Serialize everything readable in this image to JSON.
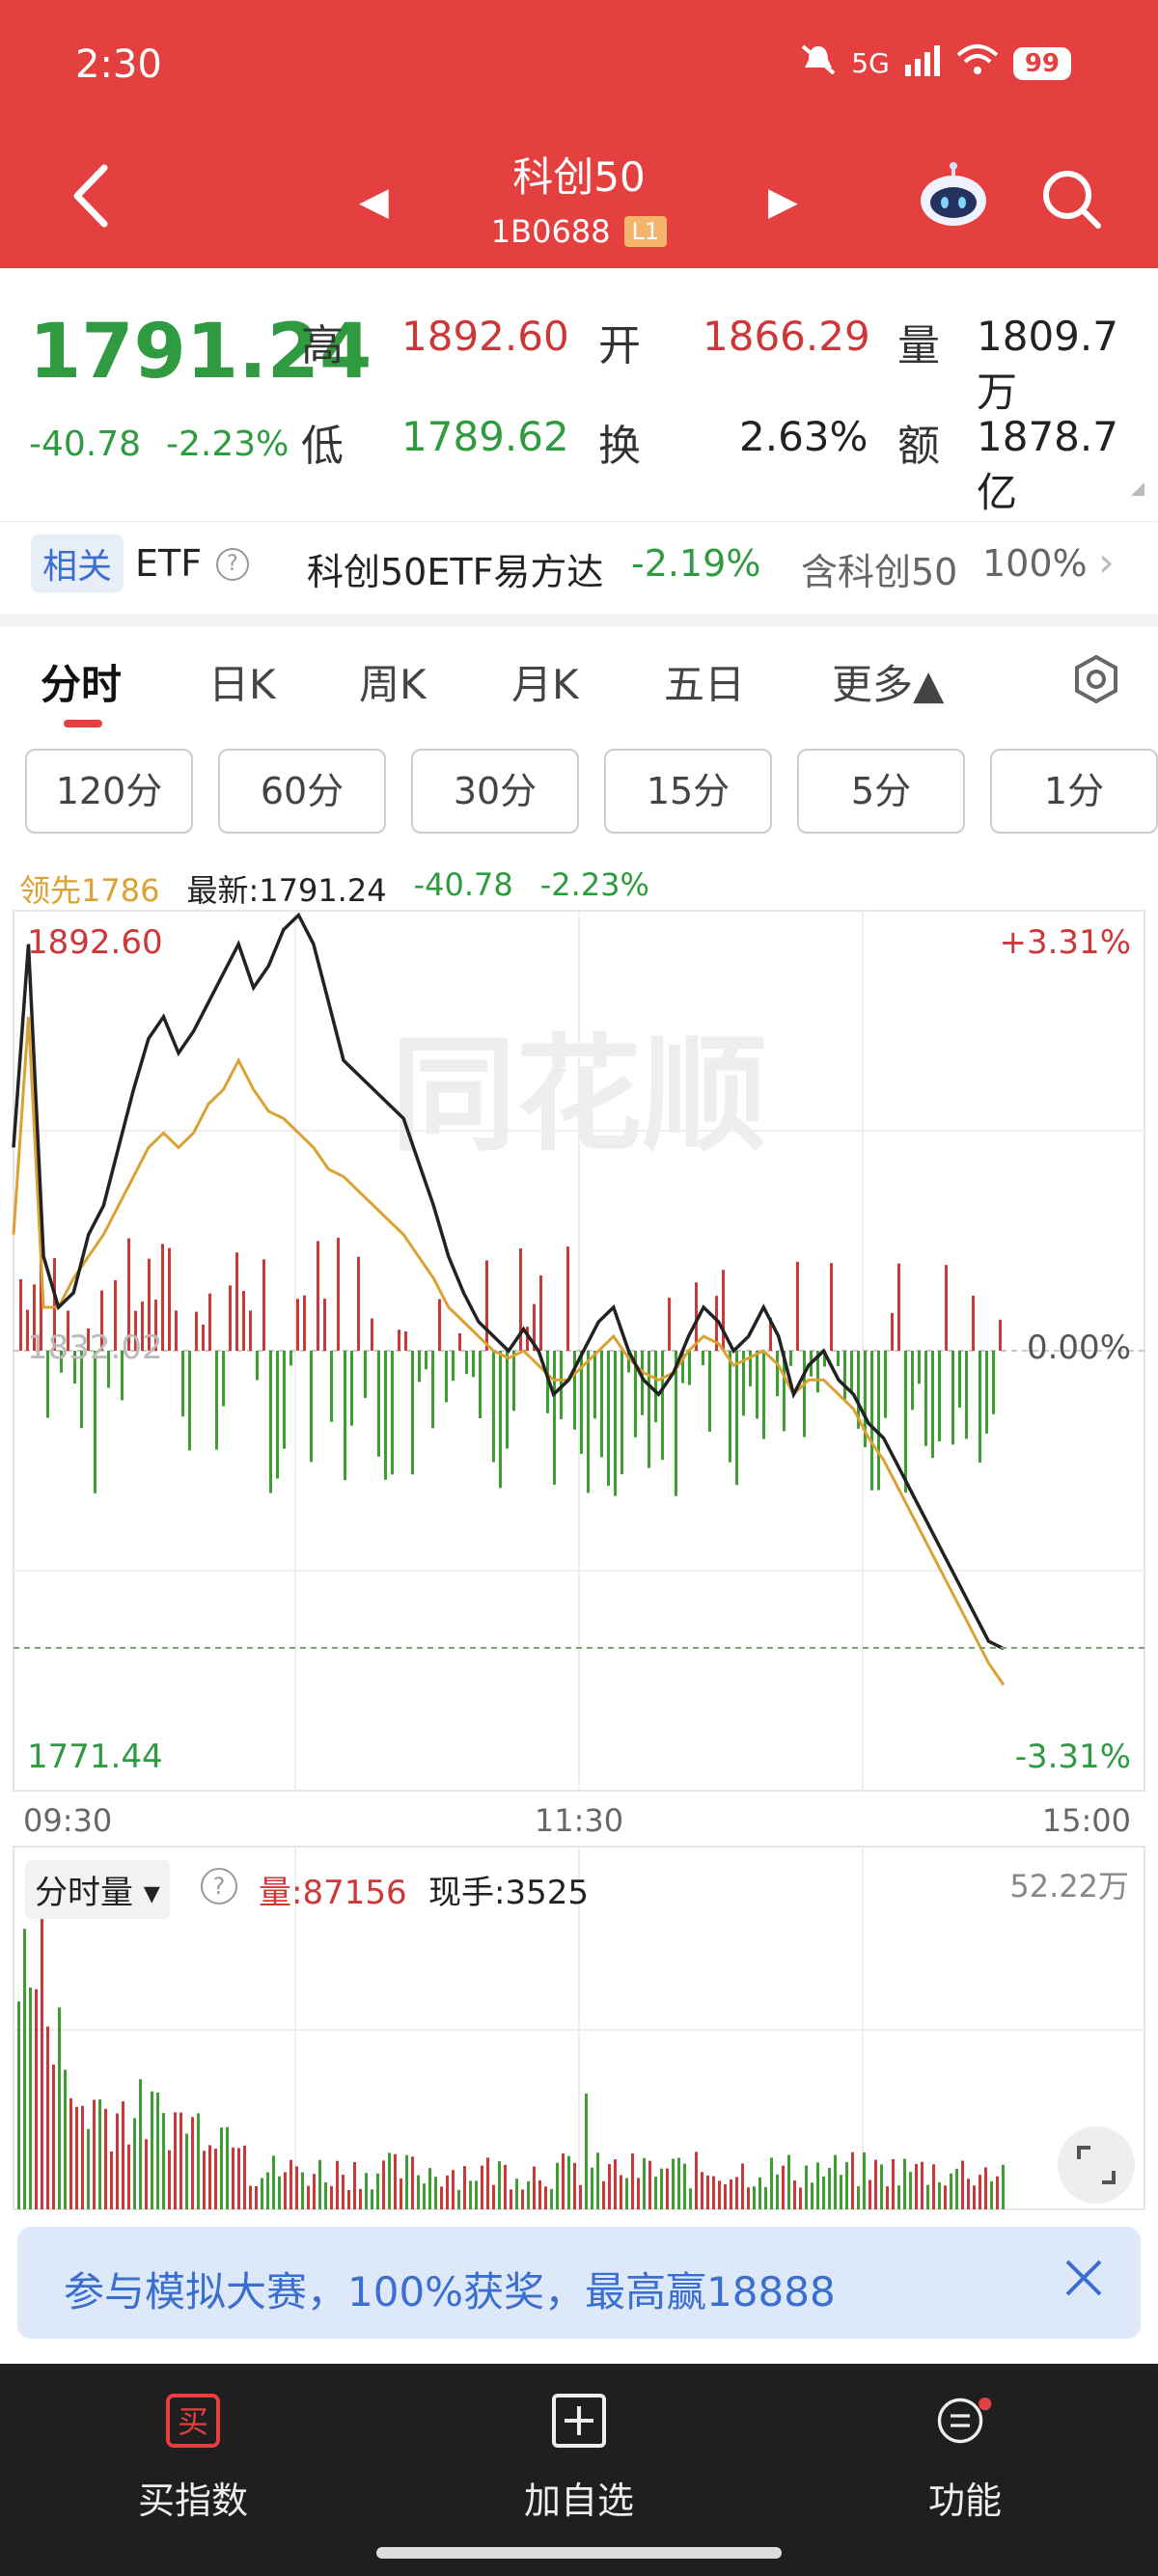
{
  "status": {
    "time": "2:30",
    "network": "5G",
    "battery": "99"
  },
  "header": {
    "title": "科创50",
    "code": "1B0688",
    "level": "L1"
  },
  "quote": {
    "price": "1791.24",
    "change": "-40.78",
    "change_pct": "-2.23%",
    "high_label": "高",
    "high": "1892.60",
    "open_label": "开",
    "open": "1866.29",
    "vol_label": "量",
    "volume": "1809.7万",
    "low_label": "低",
    "low": "1789.62",
    "turn_label": "换",
    "turnover": "2.63%",
    "amt_label": "额",
    "amount": "1878.7亿"
  },
  "etf": {
    "related": "相关",
    "label": "ETF",
    "help": "?",
    "name": "科创50ETF易方达",
    "change_pct": "-2.19%",
    "contains": "含科创50",
    "weight": "100%"
  },
  "tabs": [
    "分时",
    "日K",
    "周K",
    "月K",
    "五日",
    "更多▲"
  ],
  "periods": [
    "120分",
    "60分",
    "30分",
    "15分",
    "5分",
    "1分"
  ],
  "chart_info": {
    "leader": "领先1786",
    "latest": "最新:1791.24",
    "change": "-40.78",
    "change_pct": "-2.23%"
  },
  "chart_labels": {
    "y_top": "1892.60",
    "y_mid": "1832.02",
    "y_bottom": "1771.44",
    "pct_top": "+3.31%",
    "pct_mid": "0.00%",
    "pct_bottom": "-3.31%",
    "x_start": "09:30",
    "x_mid": "11:30",
    "x_end": "15:00",
    "watermark": "同花顺"
  },
  "volume_panel": {
    "mode": "分时量 ▾",
    "help": "?",
    "volume": "量:87156",
    "hand": "现手:3525",
    "max": "52.22万"
  },
  "banner": {
    "text": "参与模拟大赛，100%获奖，最高赢18888"
  },
  "bottom_nav": [
    "买指数",
    "加自选",
    "功能"
  ],
  "colors": {
    "header_red": "#e3403f",
    "up_red": "#cc3838",
    "down_green": "#2f9a3f",
    "price_line": "#222222",
    "avg_line": "#d9a233",
    "accent_blue": "#3a6fd1"
  },
  "chart_data": {
    "type": "line",
    "x_range": [
      "09:30",
      "15:00"
    ],
    "y_range": [
      1771.44,
      1892.6
    ],
    "prev_close": 1832.02,
    "series": [
      {
        "values": [
          1860,
          1888,
          1845,
          1838,
          1840,
          1848,
          1852,
          1860,
          1868,
          1875,
          1878,
          1873,
          1876,
          1880,
          1884,
          1888,
          1882,
          1885,
          1890,
          1892,
          1888,
          1880,
          1872,
          1870,
          1868,
          1866,
          1864,
          1858,
          1852,
          1845,
          1840,
          1836,
          1834,
          1832,
          1835,
          1832,
          1826,
          1828,
          1832,
          1836,
          1838,
          1832,
          1828,
          1826,
          1829,
          1834,
          1838,
          1836,
          1832,
          1834,
          1838,
          1834,
          1826,
          1830,
          1832,
          1828,
          1826,
          1822,
          1820,
          1816,
          1812,
          1808,
          1804,
          1800,
          1796,
          1792,
          1791
        ]
      },
      {
        "values": [
          1848,
          1878,
          1838,
          1838,
          1842,
          1845,
          1848,
          1852,
          1856,
          1860,
          1862,
          1860,
          1862,
          1866,
          1868,
          1872,
          1868,
          1865,
          1864,
          1862,
          1860,
          1857,
          1856,
          1854,
          1852,
          1850,
          1848,
          1845,
          1842,
          1838,
          1836,
          1834,
          1832,
          1831,
          1832,
          1830,
          1828,
          1828,
          1830,
          1832,
          1834,
          1831,
          1829,
          1828,
          1829,
          1832,
          1834,
          1833,
          1830,
          1831,
          1832,
          1830,
          1826,
          1828,
          1828,
          1826,
          1824,
          1820,
          1817,
          1813,
          1809,
          1805,
          1801,
          1797,
          1793,
          1789,
          1786
        ]
      }
    ]
  }
}
